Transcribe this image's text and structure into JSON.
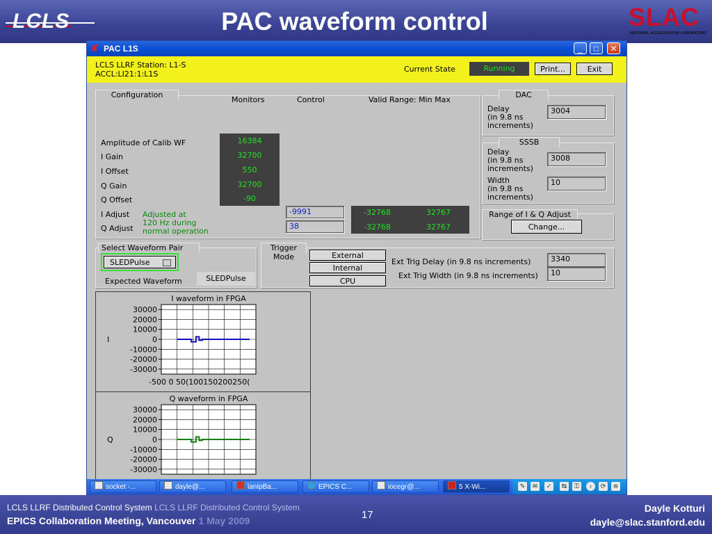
{
  "slide": {
    "title": "PAC waveform control",
    "lcls_logo_text": "LCLS",
    "slac_logo": "SLAC",
    "slac_subtitle": "NATIONAL ACCELERATOR LABORATORY",
    "footer_line1": "LCLS LLRF Distributed Control System",
    "footer_line1_ghost": "LCLS LLRF Distributed Control System",
    "footer_line2": "EPICS Collaboration Meeting, Vancouver",
    "footer_line2_ghost": "1 May 2009",
    "slide_number": "17",
    "author": "Dayle Kotturi",
    "email": "dayle@slac.stanford.edu"
  },
  "window": {
    "title": "PAC L1S",
    "minimize": "_",
    "maximize": "□",
    "close": "✕",
    "icon": "✘"
  },
  "station": {
    "line1": "LCLS LLRF Station: L1-S",
    "line2": "ACCL:LI21:1:L1S",
    "current_state_label": "Current State",
    "current_state": "Running",
    "print": "Print...",
    "exit": "Exit"
  },
  "configuration": {
    "title": "Configuration",
    "col_monitors": "Monitors",
    "col_control": "Control",
    "col_valid_range": "Valid Range: Min Max",
    "rows": [
      {
        "label": "Amplitude of Calib WF",
        "monitor": "16384"
      },
      {
        "label": "I Gain",
        "monitor": "32700"
      },
      {
        "label": "I Offset",
        "monitor": "550"
      },
      {
        "label": "Q Gain",
        "monitor": "32700"
      },
      {
        "label": "Q Offset",
        "monitor": "-90"
      }
    ],
    "i_adjust_label": "I Adjust",
    "q_adjust_label": "Q Adjust",
    "adjust_note_1": "Adjusted at",
    "adjust_note_2": "120 Hz during",
    "adjust_note_3": "normal operation",
    "i_adjust_control": "-9991",
    "q_adjust_control": "38",
    "i_range_min": "-32768",
    "i_range_max": "32767",
    "q_range_min": "-32768",
    "q_range_max": "32767"
  },
  "dac": {
    "title": "DAC",
    "delay_l1": "Delay",
    "delay_l2": "(in 9.8 ns",
    "delay_l3": "increments)",
    "delay_value": "3004"
  },
  "sssb": {
    "title": "SSSB",
    "delay_l1": "Delay",
    "delay_l2": "(in 9.8 ns",
    "delay_l3": "increments)",
    "delay_value": "3008",
    "width_l1": "Width",
    "width_l2": "(in 9.8 ns",
    "width_l3": "increments)",
    "width_value": "10"
  },
  "range_adjust": {
    "title": "Range of I & Q Adjust",
    "change": "Change..."
  },
  "waveform_pair": {
    "title": "Select Waveform Pair",
    "selected": "SLEDPulse",
    "expected_label": "Expected Waveform",
    "expected_value": "SLEDPulse"
  },
  "trigger": {
    "title_l1": "Trigger",
    "title_l2": "Mode",
    "external": "External",
    "internal": "Internal",
    "cpu": "CPU",
    "delay_label": "Ext Trig Delay (in 9.8 ns increments)",
    "delay_value": "3340",
    "width_label": "Ext Trig Width (in 9.8 ns increments)",
    "width_value": "10"
  },
  "chart_data": [
    {
      "type": "line",
      "title": "I waveform in FPGA",
      "ylabel": "I",
      "xlabel": "",
      "xlim": [
        -500,
        2500
      ],
      "ylim": [
        -35000,
        35000
      ],
      "yticks": [
        "30000",
        "20000",
        "10000",
        "0",
        "-10000",
        "-20000",
        "-30000"
      ],
      "xtick_label": "-500 0  50(100150200250(",
      "grid": true,
      "color": "#1010c0",
      "x": [
        0,
        450,
        450,
        600,
        600,
        700,
        700,
        800,
        800,
        2300
      ],
      "y": [
        0,
        0,
        -2500,
        -2500,
        2500,
        2500,
        -1000,
        -1000,
        0,
        0
      ]
    },
    {
      "type": "line",
      "title": "Q waveform in FPGA",
      "ylabel": "Q",
      "xlabel": "",
      "xlim": [
        -500,
        2500
      ],
      "ylim": [
        -35000,
        35000
      ],
      "yticks": [
        "30000",
        "20000",
        "10000",
        "0",
        "-10000",
        "-20000",
        "-30000"
      ],
      "grid": true,
      "color": "#108010",
      "x": [
        0,
        450,
        450,
        600,
        600,
        700,
        700,
        800,
        800,
        2300
      ],
      "y": [
        0,
        0,
        -2500,
        -2500,
        2500,
        2500,
        -1000,
        -1000,
        0,
        0
      ]
    }
  ],
  "taskbar": {
    "items": [
      {
        "label": "socket -..."
      },
      {
        "label": "dayle@..."
      },
      {
        "label": "lanIpBa..."
      },
      {
        "label": "EPICS C..."
      },
      {
        "label": "iocegr@..."
      },
      {
        "label": "5 X-Wi..."
      }
    ]
  }
}
